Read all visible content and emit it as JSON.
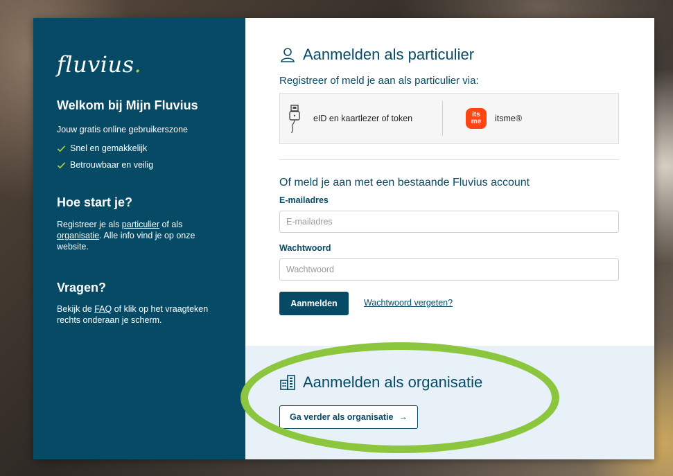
{
  "brand": {
    "logo_text": "fluvius",
    "logo_dot": "."
  },
  "left": {
    "welcome_title": "Welkom bij Mijn Fluvius",
    "welcome_text": "Jouw gratis online gebruikerszone",
    "checks": [
      "Snel en gemakkelijk",
      "Betrouwbaar en veilig"
    ],
    "start_title": "Hoe start je?",
    "start_text_1": "Registreer je als ",
    "start_link_1": "particulier",
    "start_text_2": " of als",
    "start_link_2": "organisatie",
    "start_text_3": ". Alle info vind je op onze website.",
    "questions_title": "Vragen?",
    "questions_text_1": "Bekijk de ",
    "questions_link": "FAQ",
    "questions_text_2": " of klik op het vraagteken rechts onderaan je scherm."
  },
  "particulier": {
    "title": "Aanmelden als particulier",
    "subtitle": "Registreer of meld je aan als particulier via:",
    "option_eid": "eID en kaartlezer of token",
    "option_itsme": "itsme®",
    "itsme_logo_top": "its",
    "itsme_logo_bottom": "me",
    "existing_title": "Of meld je aan met een bestaande Fluvius account",
    "email_label": "E-mailadres",
    "email_placeholder": "E-mailadres",
    "email_value": "",
    "password_label": "Wachtwoord",
    "password_placeholder": "Wachtwoord",
    "password_value": "",
    "login_button": "Aanmelden",
    "forgot_link": "Wachtwoord vergeten?"
  },
  "organisatie": {
    "title": "Aanmelden als organisatie",
    "button": "Ga verder als organisatie",
    "button_arrow": "→"
  },
  "colors": {
    "brand_dark": "#064a66",
    "brand_green": "#b3d334",
    "itsme": "#ff4612",
    "highlight": "#8cc63f",
    "org_bg": "#e8f1f7"
  }
}
